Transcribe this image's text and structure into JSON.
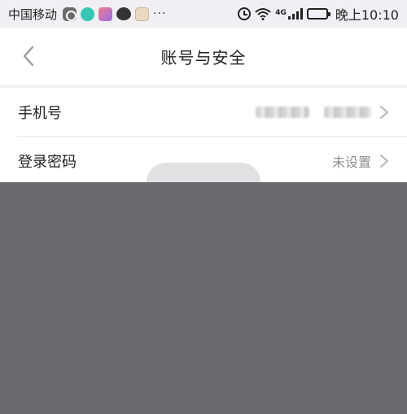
{
  "status_bar": {
    "carrier": "中国移动",
    "more": "···",
    "network": "4G",
    "time": "晚上10:10",
    "battery_level": 0.3,
    "icons": [
      "app-icon",
      "chat-app-icon",
      "photo-app-icon",
      "message-icon",
      "notification-icon",
      "alarm-icon",
      "wifi-icon",
      "signal-icon",
      "battery-icon"
    ]
  },
  "nav": {
    "back_icon": "chevron-left-icon",
    "title": "账号与安全"
  },
  "settings": {
    "rows": [
      {
        "label": "手机号",
        "value": "",
        "value_masked": true,
        "icon": "chevron-right-icon"
      },
      {
        "label": "登录密码",
        "value": "未设置",
        "value_masked": false,
        "icon": "chevron-right-icon"
      }
    ]
  },
  "loading": {
    "label": ""
  },
  "colors": {
    "status_bar_bg": "#f1eff3",
    "overlay": "#6c6a6e",
    "secondary_text": "#8e8e93"
  }
}
